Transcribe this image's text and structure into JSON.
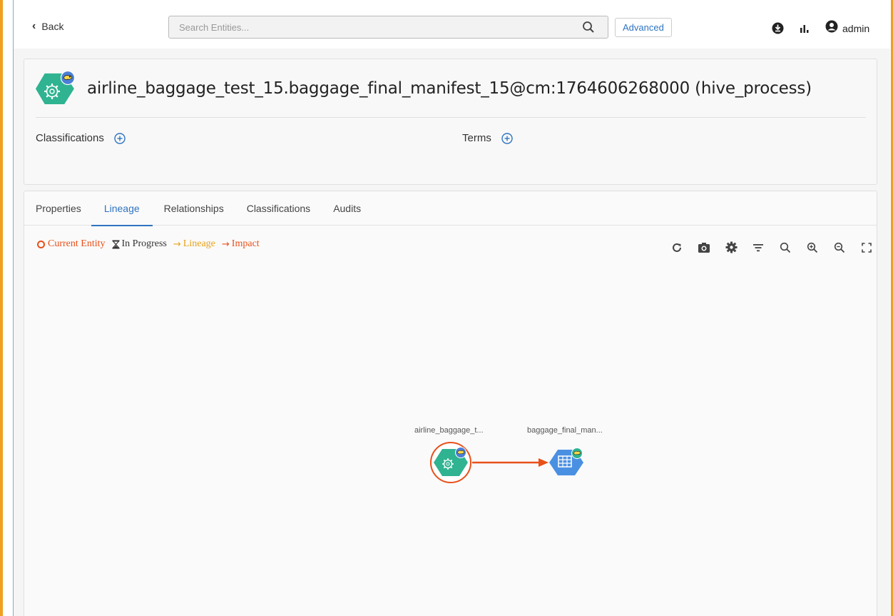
{
  "topbar": {
    "back_label": "Back",
    "search_placeholder": "Search Entities...",
    "advanced_label": "Advanced",
    "user_label": "admin",
    "icons": [
      "download-icon",
      "stats-icon",
      "user-circle-icon",
      "search-icon"
    ]
  },
  "entity": {
    "title": "airline_baggage_test_15.baggage_final_manifest_15@cm:1764606268000 (hive_process)",
    "type_icon": "process-gear-icon",
    "classifications_label": "Classifications",
    "terms_label": "Terms"
  },
  "tabs": [
    {
      "label": "Properties",
      "active": false
    },
    {
      "label": "Lineage",
      "active": true
    },
    {
      "label": "Relationships",
      "active": false
    },
    {
      "label": "Classifications",
      "active": false
    },
    {
      "label": "Audits",
      "active": false
    }
  ],
  "legend": {
    "current": "Current Entity",
    "progress": "In Progress",
    "lineage": "Lineage",
    "impact": "Impact"
  },
  "toolbar": [
    "refresh-icon",
    "camera-icon",
    "settings-icon",
    "filter-icon",
    "search-icon",
    "zoom-in-icon",
    "zoom-out-icon",
    "fullscreen-icon"
  ],
  "lineage": {
    "nodes": [
      {
        "label": "airline_baggage_t...",
        "kind": "process",
        "current": true
      },
      {
        "label": "baggage_final_man...",
        "kind": "table",
        "current": false
      }
    ]
  },
  "colors": {
    "accent_blue": "#2f74c0",
    "process_green": "#2fb391",
    "table_blue": "#4a90e2",
    "impact_red": "#e8501a",
    "lineage_orange": "#e8a21a"
  }
}
